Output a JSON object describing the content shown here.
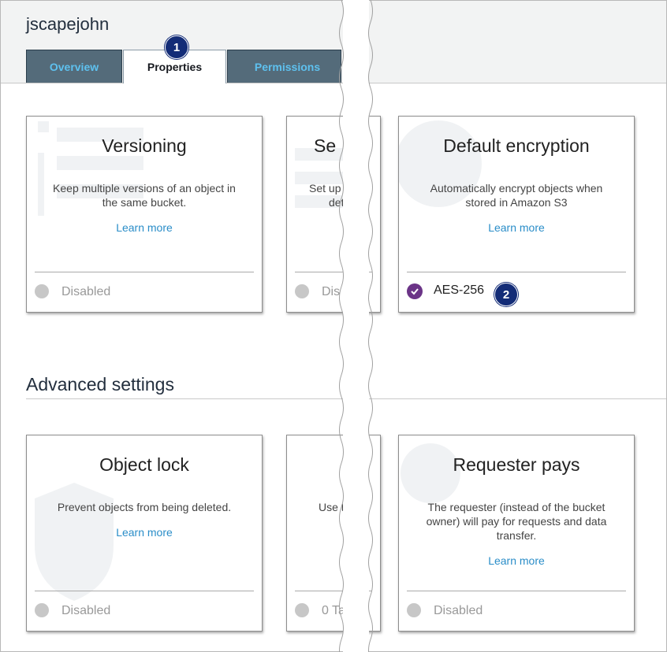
{
  "bucket": {
    "name": "jscapejohn"
  },
  "tabs": [
    {
      "label": "Overview"
    },
    {
      "label": "Properties"
    },
    {
      "label": "Permissions"
    }
  ],
  "callouts": {
    "one": "1",
    "two": "2"
  },
  "top_cards": {
    "versioning": {
      "title": "Versioning",
      "description": "Keep multiple versions of an object in the same bucket.",
      "link": "Learn more",
      "status": "Disabled"
    },
    "partial": {
      "title_fragment": "Se",
      "description_fragment_1": "Set up",
      "description_fragment_2": "det",
      "status_fragment": "Dis"
    },
    "encryption": {
      "title": "Default encryption",
      "description": "Automatically encrypt objects when stored in Amazon S3",
      "link": "Learn more",
      "status": "AES-256"
    }
  },
  "advanced": {
    "heading": "Advanced settings",
    "object_lock": {
      "title": "Object lock",
      "description": "Prevent objects from being deleted.",
      "link": "Learn more",
      "status": "Disabled"
    },
    "partial": {
      "description_fragment": "Use t",
      "status_fragment": "0 Ta"
    },
    "requester_pays": {
      "title": "Requester pays",
      "description": "The requester (instead of the bucket owner) will pay for requests and data transfer.",
      "link": "Learn more",
      "status": "Disabled"
    }
  },
  "colors": {
    "tab_dark": "#546b7a",
    "tab_text": "#5ec1ef",
    "link": "#2a8dc8",
    "badge": "#132c77",
    "check": "#6b3487"
  }
}
